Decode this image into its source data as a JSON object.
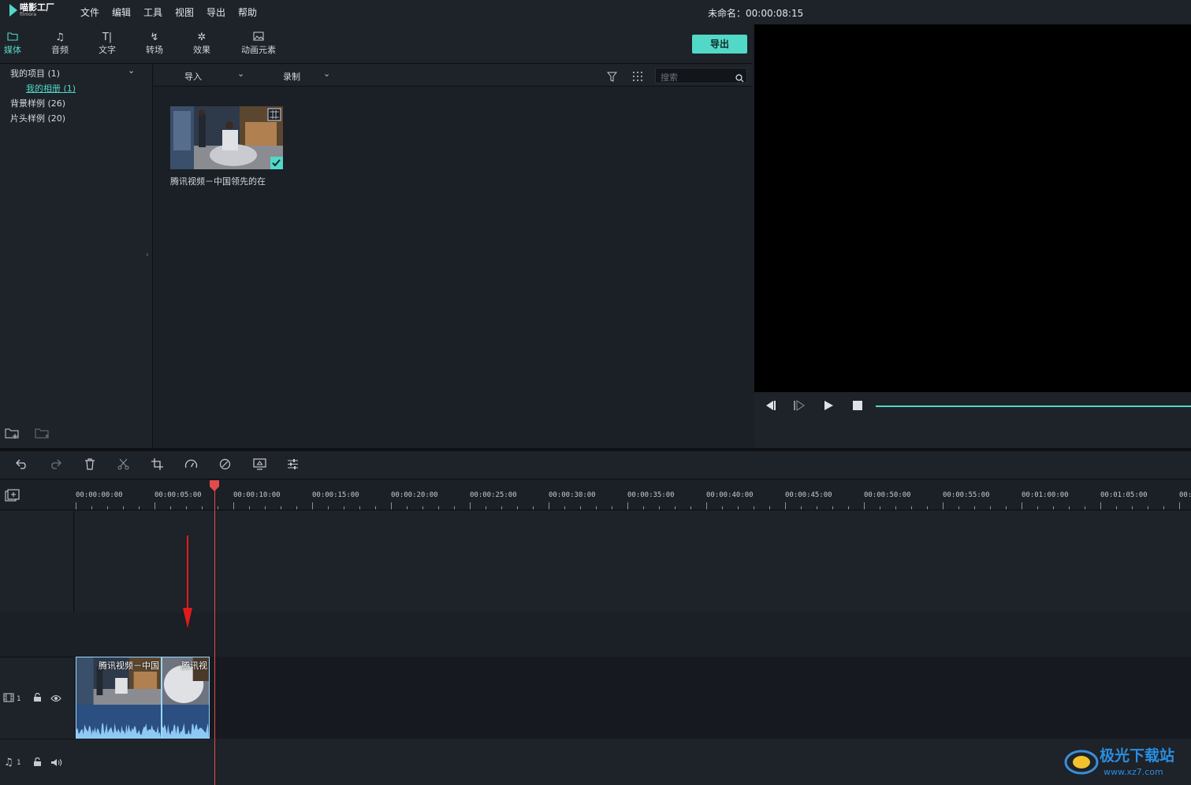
{
  "app": {
    "logo_text": "喵影工厂",
    "logo_sub": "filmora"
  },
  "menu": [
    "文件",
    "编辑",
    "工具",
    "视图",
    "导出",
    "帮助"
  ],
  "project": {
    "title": "未命名：00:00:08:15"
  },
  "tabs": [
    {
      "label": "媒体",
      "icon": "folder-icon"
    },
    {
      "label": "音频",
      "icon": "music-note-icon"
    },
    {
      "label": "文字",
      "icon": "text-icon"
    },
    {
      "label": "转场",
      "icon": "transition-icon"
    },
    {
      "label": "效果",
      "icon": "effects-icon"
    },
    {
      "label": "动画元素",
      "icon": "image-icon"
    }
  ],
  "export_label": "导出",
  "tree": {
    "items": [
      {
        "label": "我的项目 (1)"
      },
      {
        "label": "我的相册 (1)"
      },
      {
        "label": "背景样例 (26)"
      },
      {
        "label": "片头样例 (20)"
      }
    ]
  },
  "browser": {
    "import_label": "导入",
    "record_label": "录制",
    "search_placeholder": "搜索",
    "media_items": [
      {
        "label": "腾讯视频－中国领先的在"
      }
    ]
  },
  "ruler": {
    "labels": [
      "00:00:00:00",
      "00:00:05:00",
      "00:00:10:00",
      "00:00:15:00",
      "00:00:20:00",
      "00:00:25:00",
      "00:00:30:00",
      "00:00:35:00",
      "00:00:40:00",
      "00:00:45:00",
      "00:00:50:00",
      "00:00:55:00",
      "00:01:00:00",
      "00:01:05:00",
      "00:"
    ]
  },
  "tracks": {
    "video": {
      "number": "1"
    },
    "audio": {
      "number": "1"
    }
  },
  "clips": [
    {
      "title": "腾讯视频－中国"
    },
    {
      "title": "腾讯视"
    }
  ],
  "watermark": {
    "text": "极光下载站",
    "url": "www.xz7.com"
  },
  "colors": {
    "accent": "#52d8c7",
    "playhead": "#e24b4b",
    "clip": "#2a4f80"
  }
}
